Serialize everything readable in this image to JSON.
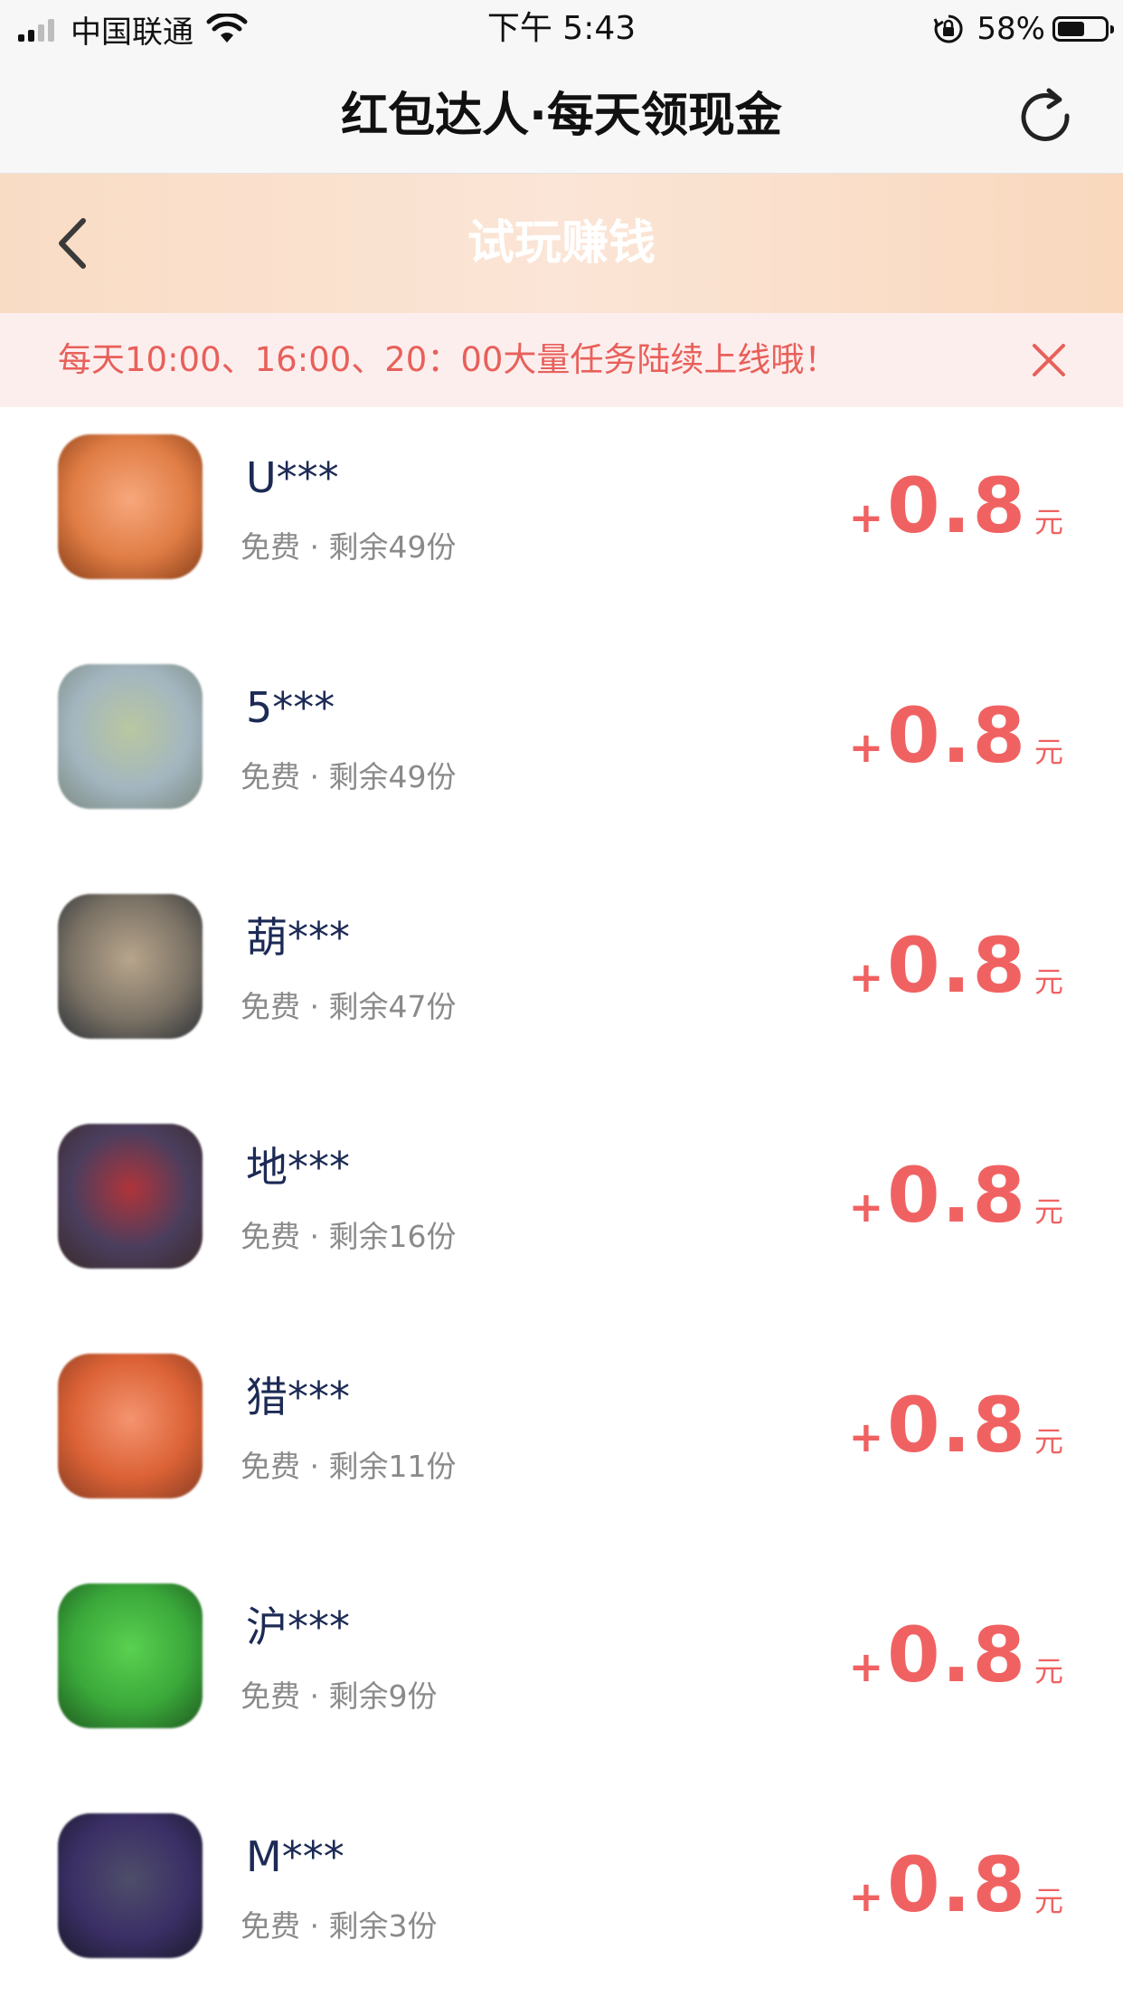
{
  "status_bar": {
    "carrier": "中国联通",
    "time": "下午 5:43",
    "battery_text": "58%",
    "battery_level": 0.58
  },
  "nav": {
    "title": "红包达人·每天领现金",
    "refresh_icon": "refresh-icon"
  },
  "header": {
    "title": "试玩赚钱",
    "back_icon": "chevron-left-icon",
    "gradient_colors": [
      "#f9dcc4",
      "#fbe5d6",
      "#f9d8bd"
    ]
  },
  "notice": {
    "text": "每天10:00、16:00、20：00大量任务陆续上线哦！",
    "close_icon": "close-icon",
    "color": "#e8605a"
  },
  "tasks": [
    {
      "name": "U***",
      "meta": "免费 · 剩余49份",
      "plus": "+",
      "amount": "0.8",
      "unit": "元",
      "icon_colors": [
        "#f7a77c",
        "#e07d45",
        "#8a3e18"
      ]
    },
    {
      "name": "5***",
      "meta": "免费 · 剩余49份",
      "plus": "+",
      "amount": "0.8",
      "unit": "元",
      "icon_colors": [
        "#b9c7a0",
        "#a3b6c0",
        "#7c8a82"
      ]
    },
    {
      "name": "葫***",
      "meta": "免费 · 剩余47份",
      "plus": "+",
      "amount": "0.8",
      "unit": "元",
      "icon_colors": [
        "#b8a58c",
        "#7c7366",
        "#2e3338"
      ]
    },
    {
      "name": "地***",
      "meta": "免费 · 剩余16份",
      "plus": "+",
      "amount": "0.8",
      "unit": "元",
      "icon_colors": [
        "#b0343a",
        "#4a3e5e",
        "#3b2a2a"
      ]
    },
    {
      "name": "猎***",
      "meta": "免费 · 剩余11份",
      "plus": "+",
      "amount": "0.8",
      "unit": "元",
      "icon_colors": [
        "#f49470",
        "#dc6236",
        "#8a3d22"
      ]
    },
    {
      "name": "沪***",
      "meta": "免费 · 剩余9份",
      "plus": "+",
      "amount": "0.8",
      "unit": "元",
      "icon_colors": [
        "#5ad150",
        "#3aa83a",
        "#1f5a1f"
      ]
    },
    {
      "name": "M***",
      "meta": "免费 · 剩余3份",
      "plus": "+",
      "amount": "0.8",
      "unit": "元",
      "icon_colors": [
        "#4e4e6a",
        "#3b2f66",
        "#1a1a2a"
      ]
    }
  ]
}
